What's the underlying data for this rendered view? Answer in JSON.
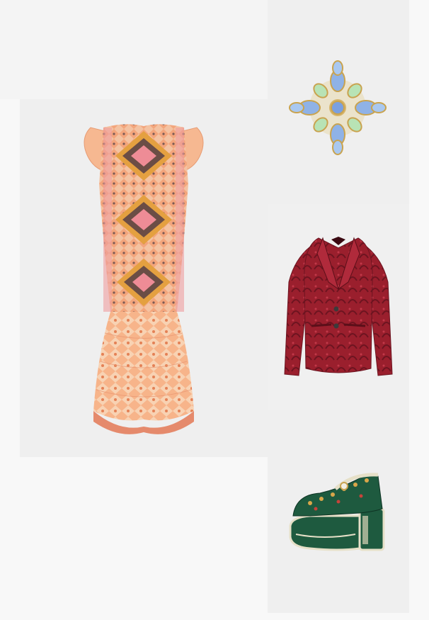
{
  "products": [
    {
      "id": "dress",
      "icon": "patterned-dress-image"
    },
    {
      "id": "brooch",
      "icon": "jeweled-brooch-image"
    },
    {
      "id": "blazer",
      "icon": "red-jacquard-blazer-image"
    },
    {
      "id": "shoe",
      "icon": "green-velvet-platform-shoe-image"
    }
  ],
  "colors": {
    "background": "#f8f8f8",
    "tile": "#efefef",
    "dress_base": "#f4b890",
    "dress_accent": "#e36c72",
    "blazer": "#9a1f2d",
    "shoe": "#1e5a3f",
    "brooch_gold": "#d6b46a",
    "brooch_blue": "#8fb2e6",
    "brooch_green": "#b8e3b5"
  }
}
